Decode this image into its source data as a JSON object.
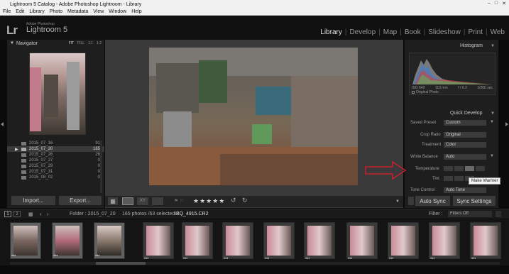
{
  "window": {
    "title": "Lightroom 5 Catalog - Adobe Photoshop Lightroom - Library",
    "controls": [
      "–",
      "□",
      "✕"
    ]
  },
  "menu": [
    "File",
    "Edit",
    "Library",
    "Photo",
    "Metadata",
    "View",
    "Window",
    "Help"
  ],
  "identity": {
    "logo": "Lr",
    "adobe": "Adobe Photoshop",
    "product": "Lightroom 5"
  },
  "modules": [
    "Library",
    "Develop",
    "Map",
    "Book",
    "Slideshow",
    "Print",
    "Web"
  ],
  "navigator": {
    "title": "Navigator",
    "zoom": [
      "FIT",
      "FILL",
      "1:1",
      "1:2"
    ]
  },
  "folders": [
    {
      "name": "2015_07_16",
      "count": "91"
    },
    {
      "name": "2015_07_20",
      "count": "165"
    },
    {
      "name": "2015_07_26",
      "count": "26"
    },
    {
      "name": "2015_07_27",
      "count": "0"
    },
    {
      "name": "2015_07_29",
      "count": "0"
    },
    {
      "name": "2015_07_31",
      "count": "0"
    },
    {
      "name": "2015_08_02",
      "count": "0"
    }
  ],
  "left_buttons": {
    "import": "Import...",
    "export": "Export..."
  },
  "histogram": {
    "title": "Histogram",
    "iso": "ISO 640",
    "focal": "113 mm",
    "aperture": "f / 6.3",
    "shutter": "1/200 sec",
    "original": "Original Photo"
  },
  "quick_develop": {
    "title": "Quick Develop",
    "saved_preset_label": "Saved Preset",
    "saved_preset": "Custom",
    "crop_label": "Crop Ratio",
    "crop": "Original",
    "treatment_label": "Treatment",
    "treatment": "Color",
    "wb_label": "White Balance",
    "wb": "Auto",
    "temperature_label": "Temperature",
    "tint_label": "Tint",
    "tone_label": "Tone Control",
    "tone": "Auto Tone",
    "tooltip": "Make Warmer"
  },
  "sync": {
    "auto": "Auto Sync",
    "settings": "Sync Settings"
  },
  "filmstrip_bar": {
    "pages": [
      "1",
      "2"
    ],
    "folder": "Folder : 2015_07_20",
    "info": "165 photos /63 selected /",
    "file": "IBQ_4915.CR2",
    "filter_label": "Filter :",
    "filter": "Filters Off"
  },
  "rating": "★★★★★",
  "thumb_dots": "•••",
  "colors": {
    "accent": "#d8d8d8",
    "panel": "#1e1e1e",
    "arrow": "#c8202a"
  }
}
